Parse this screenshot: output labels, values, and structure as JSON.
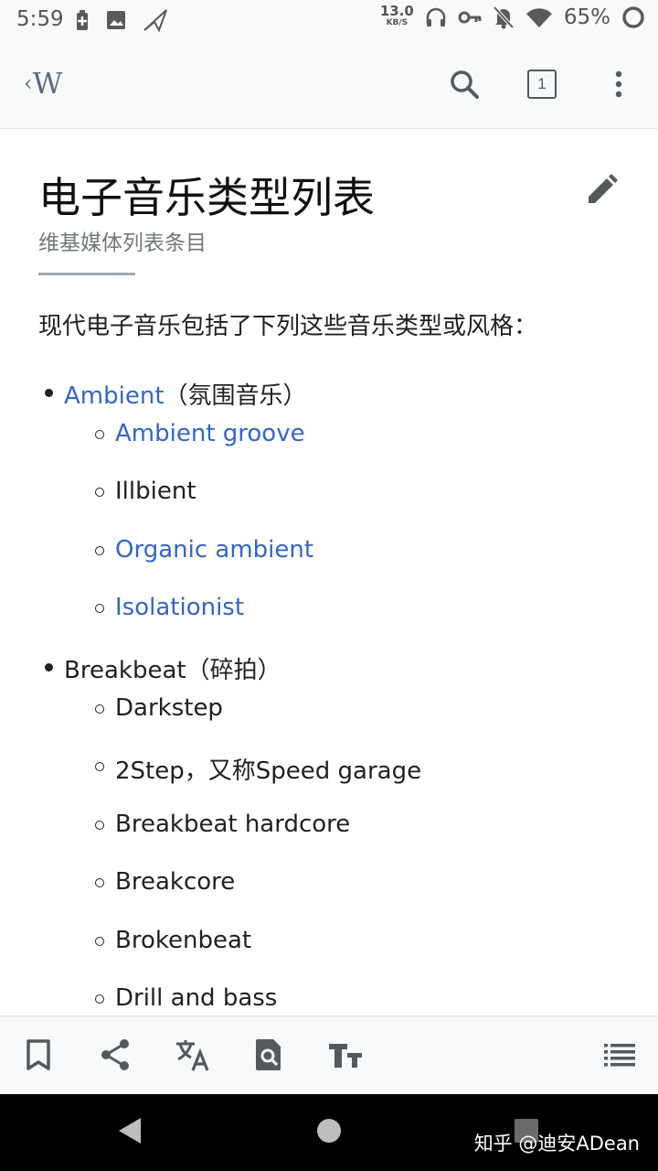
{
  "status_bar": {
    "time": "5:59",
    "net_speed": "13.0",
    "net_unit": "KB/S",
    "battery": "65%",
    "icons": [
      "battery-saver-icon",
      "image-icon",
      "send-icon",
      "headphones-icon",
      "vpn-key-icon",
      "notifications-off-icon",
      "wifi-icon",
      "battery-ring-icon"
    ]
  },
  "app_bar": {
    "logo": "W",
    "tab_count": "1",
    "icons": [
      "back-icon",
      "search-icon",
      "tabs-icon",
      "overflow-menu-icon"
    ]
  },
  "article": {
    "title": "电子音乐类型列表",
    "subtitle": "维基媒体列表条目",
    "intro": "现代电子音乐包括了下列这些音乐类型或风格：",
    "sections": [
      {
        "name": "Ambient",
        "note": "（氛围音乐）",
        "is_link": true,
        "items": [
          {
            "label": "Ambient groove",
            "is_link": true
          },
          {
            "label": "Illbient",
            "is_link": false
          },
          {
            "label": "Organic ambient",
            "is_link": true
          },
          {
            "label": "Isolationist",
            "is_link": true
          }
        ]
      },
      {
        "name": "Breakbeat",
        "note": "（碎拍）",
        "is_link": false,
        "items": [
          {
            "label": "Darkstep",
            "is_link": false
          },
          {
            "label": "2Step，又称Speed garage",
            "is_link": false
          },
          {
            "label": "Breakbeat hardcore",
            "is_link": false
          },
          {
            "label": "Breakcore",
            "is_link": false
          },
          {
            "label": "Brokenbeat",
            "is_link": false
          },
          {
            "label": "Drill and bass",
            "is_link": false
          }
        ]
      }
    ]
  },
  "toolbar": {
    "icons": [
      "bookmark-icon",
      "share-icon",
      "translate-icon",
      "find-in-page-icon",
      "text-size-icon",
      "contents-icon"
    ]
  },
  "watermark": "知乎 @迪安ADean",
  "colors": {
    "link": "#3366cc",
    "text": "#202122",
    "subtle": "#72777d",
    "bar_bg": "#f8f9fa"
  }
}
